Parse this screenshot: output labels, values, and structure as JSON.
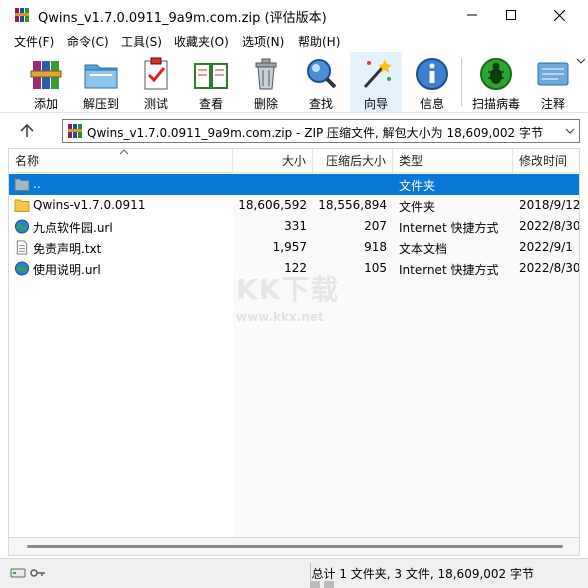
{
  "window": {
    "title": "Qwins_v1.7.0.0911_9a9m.com.zip (评估版本)"
  },
  "menu": [
    "文件(F)",
    "命令(C)",
    "工具(S)",
    "收藏夹(O)",
    "选项(N)",
    "帮助(H)"
  ],
  "toolbar": {
    "add": "添加",
    "extract": "解压到",
    "test": "测试",
    "view": "查看",
    "delete": "删除",
    "find": "查找",
    "wizard": "向导",
    "info": "信息",
    "virus": "扫描病毒",
    "comment": "注释"
  },
  "address": {
    "path": "Qwins_v1.7.0.0911_9a9m.com.zip - ZIP 压缩文件, 解包大小为 18,609,002 字节"
  },
  "columns": {
    "name": "名称",
    "size": "大小",
    "packed": "压缩后大小",
    "type": "类型",
    "modified": "修改时间"
  },
  "files": [
    {
      "name": "..",
      "size": "",
      "packed": "",
      "type": "文件夹",
      "modified": "",
      "icon": "folder-up-icon"
    },
    {
      "name": "Qwins-v1.7.0.0911",
      "size": "18,606,592",
      "packed": "18,556,894",
      "type": "文件夹",
      "modified": "2018/9/12",
      "icon": "folder-icon"
    },
    {
      "name": "九点软件园.url",
      "size": "331",
      "packed": "207",
      "type": "Internet 快捷方式",
      "modified": "2022/8/30",
      "icon": "globe-icon"
    },
    {
      "name": "免责声明.txt",
      "size": "1,957",
      "packed": "918",
      "type": "文本文档",
      "modified": "2022/9/1",
      "icon": "text-file-icon"
    },
    {
      "name": "使用说明.url",
      "size": "122",
      "packed": "105",
      "type": "Internet 快捷方式",
      "modified": "2022/8/30",
      "icon": "globe-icon"
    }
  ],
  "status": {
    "summary": "总计 1 文件夹, 3 文件, 18,609,002 字节"
  },
  "watermark": {
    "brand": "KK下载",
    "url": "www.kkx.net"
  },
  "colors": {
    "selection": "#0a78d7",
    "hover": "#e5f1fb"
  }
}
